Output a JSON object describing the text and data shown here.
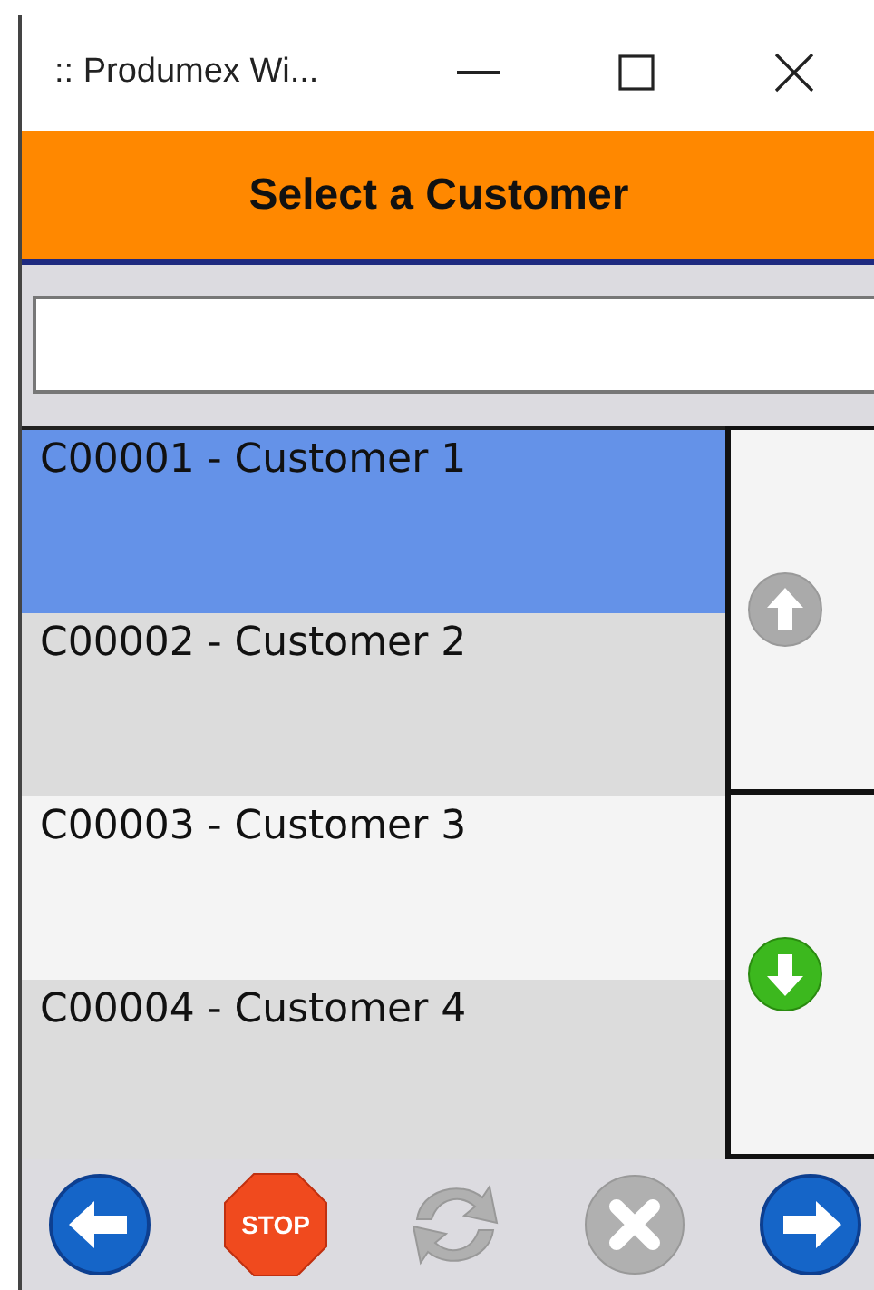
{
  "window": {
    "title": ":: Produmex Wi..."
  },
  "header": {
    "title": "Select a Customer"
  },
  "customers": [
    {
      "label": "C00001 - Customer 1",
      "selected": true
    },
    {
      "label": "C00002 - Customer 2",
      "selected": false
    },
    {
      "label": "C00003 - Customer 3",
      "selected": false
    },
    {
      "label": "C00004 - Customer 4",
      "selected": false
    }
  ],
  "scroll_buttons": [
    {
      "kind": "up",
      "disabled": true
    },
    {
      "kind": "down",
      "disabled": false
    }
  ],
  "toolbar": [
    {
      "kind": "back",
      "disabled": false
    },
    {
      "kind": "stop",
      "label": "STOP",
      "disabled": false
    },
    {
      "kind": "refresh",
      "disabled": true
    },
    {
      "kind": "cancel",
      "disabled": true
    },
    {
      "kind": "forward",
      "disabled": false
    }
  ]
}
